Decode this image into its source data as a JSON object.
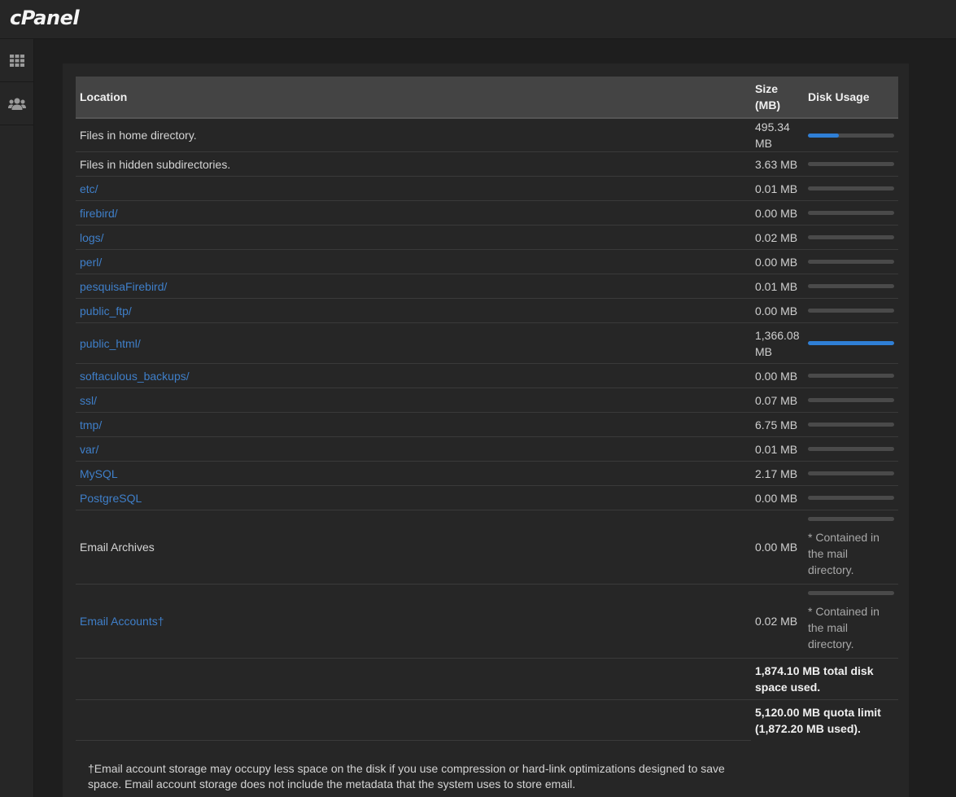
{
  "app": {
    "logo": "cPanel"
  },
  "sidebar": {
    "items": [
      {
        "icon": "grid-icon"
      },
      {
        "icon": "users-icon"
      }
    ]
  },
  "table": {
    "headers": {
      "location": "Location",
      "size": "Size (MB)",
      "usage": "Disk Usage"
    },
    "rows": [
      {
        "location": "Files in home directory.",
        "size": "495.34 MB",
        "usage": 0.36,
        "link": false
      },
      {
        "location": "Files in hidden subdirectories.",
        "size": "3.63 MB",
        "usage": 0,
        "link": false
      },
      {
        "location": "etc/",
        "size": "0.01 MB",
        "usage": 0,
        "link": true
      },
      {
        "location": "firebird/",
        "size": "0.00 MB",
        "usage": 0,
        "link": true
      },
      {
        "location": "logs/",
        "size": "0.02 MB",
        "usage": 0,
        "link": true
      },
      {
        "location": "perl/",
        "size": "0.00 MB",
        "usage": 0,
        "link": true
      },
      {
        "location": "pesquisaFirebird/",
        "size": "0.01 MB",
        "usage": 0,
        "link": true
      },
      {
        "location": "public_ftp/",
        "size": "0.00 MB",
        "usage": 0,
        "link": true
      },
      {
        "location": "public_html/",
        "size": "1,366.08 MB",
        "usage": 1.0,
        "link": true
      },
      {
        "location": "softaculous_backups/",
        "size": "0.00 MB",
        "usage": 0,
        "link": true
      },
      {
        "location": "ssl/",
        "size": "0.07 MB",
        "usage": 0,
        "link": true
      },
      {
        "location": "tmp/",
        "size": "6.75 MB",
        "usage": 0,
        "link": true
      },
      {
        "location": "var/",
        "size": "0.01 MB",
        "usage": 0,
        "link": true
      },
      {
        "location": "MySQL",
        "size": "2.17 MB",
        "usage": 0,
        "link": true
      },
      {
        "location": "PostgreSQL",
        "size": "0.00 MB",
        "usage": 0,
        "link": true
      },
      {
        "location": "Email Archives",
        "size": "0.00 MB",
        "usage": 0,
        "link": false,
        "note": "* Contained in the mail directory."
      },
      {
        "location": "Email Accounts†",
        "size": "0.02 MB",
        "usage": 0,
        "link": true,
        "note": "* Contained in the mail directory."
      }
    ],
    "total": "1,874.10 MB total disk space used.",
    "quota": "5,120.00 MB quota limit (1,872.20 MB used)."
  },
  "footnote": "†Email account storage may occupy less space on the disk if you use compression or hard-link optimizations designed to save space. Email account storage does not include the metadata that the system uses to store email.",
  "colors": {
    "link": "#3f7fc9",
    "bar_fill": "#2f7fd6",
    "bar_track": "#4a4a4a"
  }
}
